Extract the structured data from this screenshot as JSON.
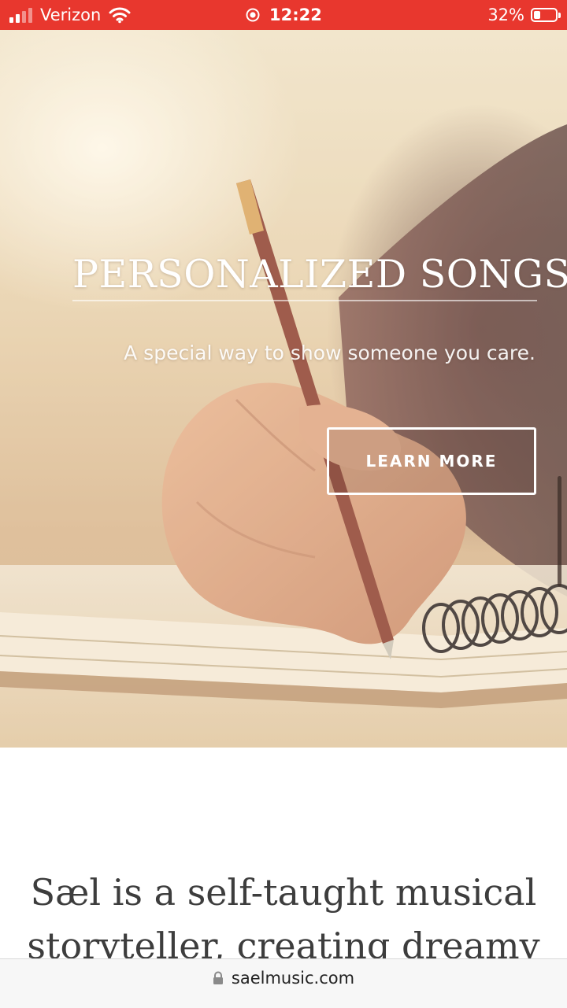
{
  "status_bar": {
    "carrier": "Verizon",
    "time": "12:22",
    "battery_percent": "32%",
    "battery_level": 0.32,
    "signal_bars": 2,
    "icons": [
      "signal-bars-icon",
      "wifi-icon",
      "screen-record-icon",
      "battery-icon"
    ],
    "background_color": "#e8372e"
  },
  "hero": {
    "title": "PERSONALIZED SONGS",
    "subtitle": "A special way to show someone you care.",
    "cta_label": "LEARN MORE",
    "image_subject": "hand-writing-in-notebook-photo"
  },
  "content": {
    "intro_text": "Sæl is a self-taught musical storyteller, creating dreamy"
  },
  "browser": {
    "url": "saelmusic.com",
    "secure_icon": "lock-icon"
  },
  "colors": {
    "status_bar": "#e8372e",
    "body_text": "#3d3d3d",
    "hero_text": "#ffffff"
  }
}
